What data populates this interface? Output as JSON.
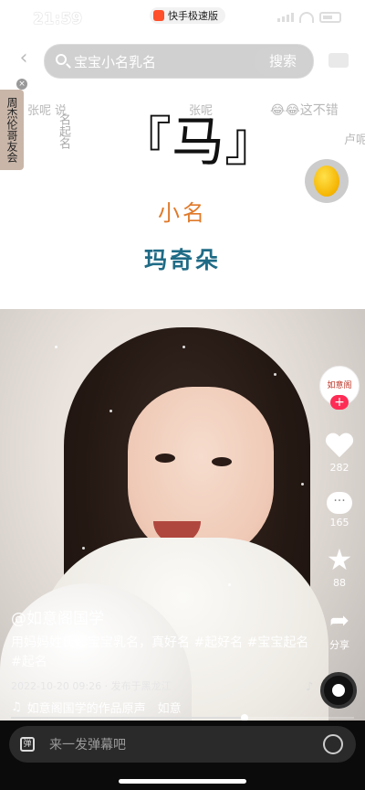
{
  "status_bar": {
    "time": "21:59",
    "app_badge": "快手极速版"
  },
  "search": {
    "query": "宝宝小名乳名",
    "button_label": "搜索"
  },
  "danmaku": [
    "张呢",
    "说",
    "张呢",
    "😂😂这不错",
    "卢呢"
  ],
  "left_tag": {
    "label": "周杰伦哥友会"
  },
  "overlay": {
    "vertical_text": "名起名",
    "bracket_title": "『马』",
    "subtitle": "小名",
    "name": "玛奇朵"
  },
  "author_avatar_text": "如意阁",
  "rail": {
    "likes": "282",
    "comments": "165",
    "favorites": "88",
    "share_label": "分享"
  },
  "caption": {
    "username": "@如意阁国学",
    "text": "用妈妈姓氏起宝宝乳名，真好名 #起好名 #宝宝起名 #起名",
    "meta": "2022-10-20 09:26 · 发布于黑龙江",
    "music": "如意阁国学的作品原声　如意"
  },
  "progress": {
    "fraction": 0.68
  },
  "bottom_bar": {
    "danmu_placeholder": "来一发弹幕吧"
  }
}
